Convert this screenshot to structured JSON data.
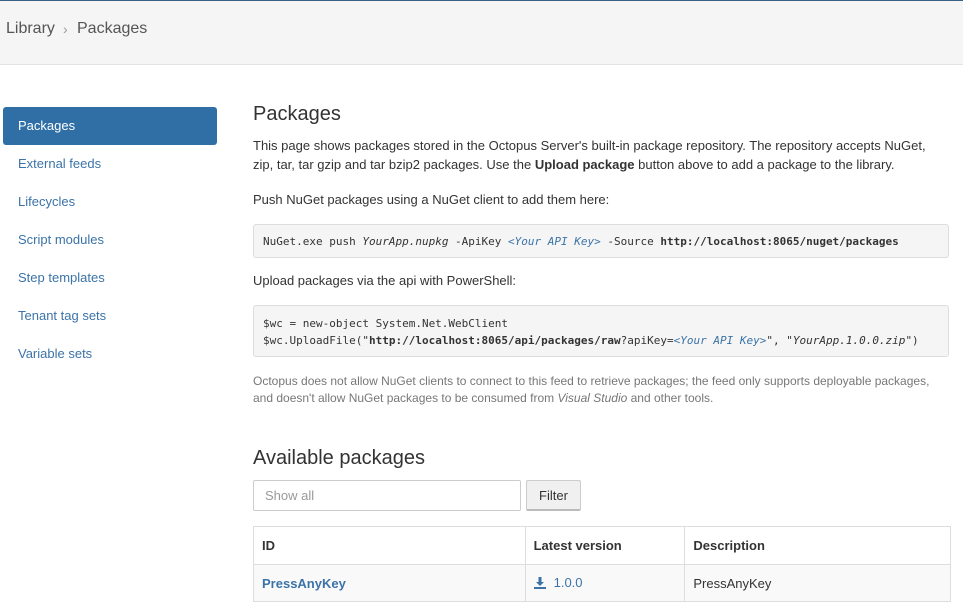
{
  "breadcrumb": {
    "root": "Library",
    "separator": "›",
    "current": "Packages"
  },
  "sidebar": {
    "items": [
      {
        "label": "Packages",
        "active": true
      },
      {
        "label": "External feeds"
      },
      {
        "label": "Lifecycles"
      },
      {
        "label": "Script modules"
      },
      {
        "label": "Step templates"
      },
      {
        "label": "Tenant tag sets"
      },
      {
        "label": "Variable sets"
      }
    ]
  },
  "main": {
    "title": "Packages",
    "intro_1": "This page shows packages stored in the Octopus Server's built-in package repository. The repository accepts NuGet,",
    "intro_2a": "zip, tar, tar gzip and tar bzip2 packages. Use the ",
    "intro_2b": "Upload package",
    "intro_2c": " button above to add a package to the library.",
    "push_label": "Push NuGet packages using a NuGet client to add them here:",
    "push_cmd": {
      "a": "NuGet.exe push ",
      "b": "YourApp.nupkg",
      "c": " -ApiKey ",
      "d": "<Your API Key>",
      "e": " -Source ",
      "f": "http://localhost:8065/nuget/packages"
    },
    "api_label": "Upload packages via the api with PowerShell:",
    "ps_line1": "$wc = new-object System.Net.WebClient",
    "ps_line2": {
      "a": "$wc.UploadFile(\"",
      "b": "http://localhost:8065/api/packages/raw",
      "c": "?apiKey=",
      "d": "<Your API Key>",
      "e": "\", \"",
      "f": "YourApp.1.0.0.zip",
      "g": "\")"
    },
    "note_1": "Octopus does not allow NuGet clients to connect to this feed to retrieve packages; the feed only supports deployable packages,",
    "note_2a": "and doesn't allow NuGet packages to be consumed from ",
    "note_2b": "Visual Studio",
    "note_2c": " and other tools."
  },
  "available": {
    "title": "Available packages",
    "search_placeholder": "Show all",
    "filter_label": "Filter",
    "columns": [
      "ID",
      "Latest version",
      "Description"
    ],
    "rows": [
      {
        "id": "PressAnyKey",
        "version": "1.0.0",
        "description": "PressAnyKey"
      }
    ]
  },
  "colors": {
    "accent": "#2f6fa6",
    "link": "#3b73a8"
  },
  "icons": {
    "download": "download-icon"
  }
}
